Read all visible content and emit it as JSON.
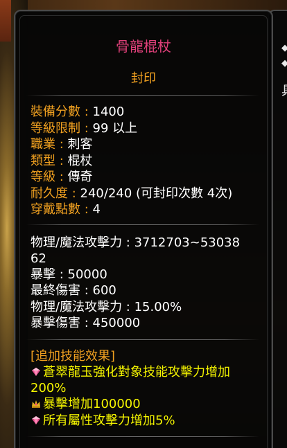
{
  "item": {
    "name": "骨龍棍杖",
    "status": "封印"
  },
  "basic_info": [
    {
      "label": "裝備分數 :",
      "value": " 1400"
    },
    {
      "label": "等級限制 :",
      "value": "  99 以上"
    },
    {
      "label": "職業 :",
      "value": "  刺客"
    },
    {
      "label": "類型 :",
      "value": "  棍杖"
    },
    {
      "label": "等級 :",
      "value": "  傳奇"
    },
    {
      "label": "耐久度 :",
      "value": "  240/240 (可封印次數 4次)"
    },
    {
      "label": "穿戴點數 :",
      "value": " 4"
    }
  ],
  "stats": [
    "物理/魔法攻擊力 : 3712703~53038",
    "62",
    "暴擊 : 50000",
    "最終傷害 : 600",
    "物理/魔法攻擊力 : 15.00%",
    "暴擊傷害 : 450000"
  ],
  "skill_effects": {
    "header": "[追加技能效果]",
    "lines": [
      {
        "icon": "pink-gem-icon",
        "text": "蒼翠龍玉強化對象技能攻擊力增加"
      },
      {
        "icon": "",
        "text": "200%"
      },
      {
        "icon": "crown-gem-icon",
        "text": "暴擊增加100000"
      },
      {
        "icon": "pink-gem-icon",
        "text": "所有屬性攻擊力增加5%"
      }
    ]
  },
  "right_panel": {
    "line1": "◆",
    "line2": "◆",
    "char": "具"
  },
  "colors": {
    "title": "#e0407a",
    "label": "#f0a020",
    "value": "#ffffff",
    "effect": "#f4f400"
  }
}
